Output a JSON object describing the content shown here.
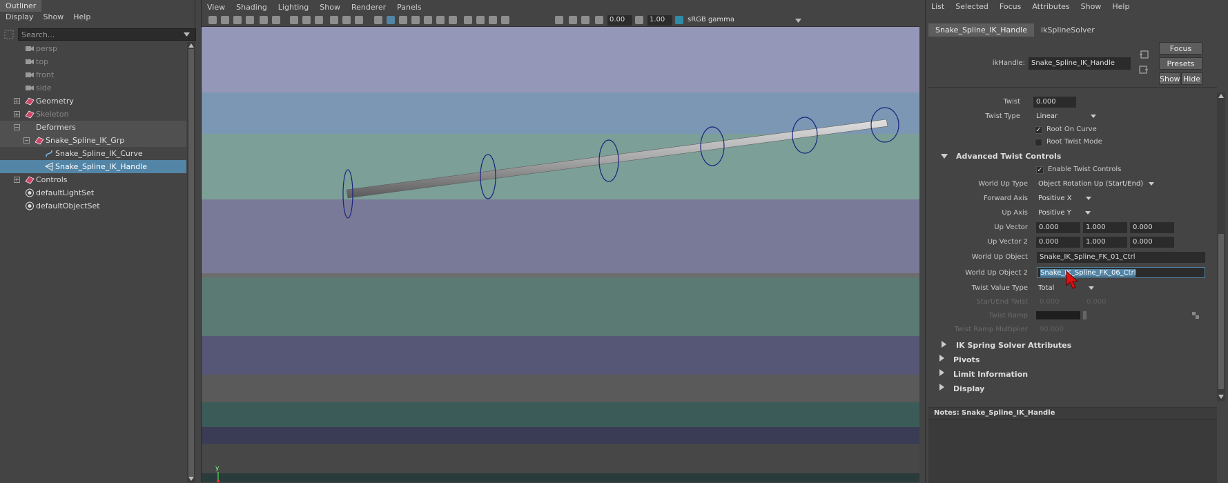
{
  "outliner": {
    "title": "Outliner",
    "menu": [
      "Display",
      "Show",
      "Help"
    ],
    "search_placeholder": "Search...",
    "items": [
      {
        "label": "persp",
        "indent": 0,
        "type": "camera",
        "dim": true
      },
      {
        "label": "top",
        "indent": 0,
        "type": "camera",
        "dim": true
      },
      {
        "label": "front",
        "indent": 0,
        "type": "camera",
        "dim": true
      },
      {
        "label": "side",
        "indent": 0,
        "type": "camera",
        "dim": true
      },
      {
        "label": "Geometry",
        "indent": 0,
        "type": "group",
        "expander": "+"
      },
      {
        "label": "Skeleton",
        "indent": 0,
        "type": "group",
        "expander": "+",
        "dim": true
      },
      {
        "label": "Deformers",
        "indent": 0,
        "type": "none",
        "expander": "-",
        "highlight": true
      },
      {
        "label": "Snake_Spline_IK_Grp",
        "indent": 1,
        "type": "group",
        "expander": "-",
        "highlight": true
      },
      {
        "label": "Snake_Spline_IK_Curve",
        "indent": 2,
        "type": "curve"
      },
      {
        "label": "Snake_Spline_IK_Handle",
        "indent": 2,
        "type": "ikhandle",
        "selected": true
      },
      {
        "label": "Controls",
        "indent": 0,
        "type": "group",
        "expander": "+"
      },
      {
        "label": "defaultLightSet",
        "indent": 0,
        "type": "set"
      },
      {
        "label": "defaultObjectSet",
        "indent": 0,
        "type": "set"
      }
    ]
  },
  "viewport": {
    "menu": [
      "View",
      "Shading",
      "Lighting",
      "Show",
      "Renderer",
      "Panels"
    ],
    "exposure": "0.00",
    "gamma": "1.00",
    "color_space": "sRGB gamma",
    "axis_label": "y"
  },
  "attribute_editor": {
    "menu": [
      "List",
      "Selected",
      "Focus",
      "Attributes",
      "Show",
      "Help"
    ],
    "tabs": [
      "Snake_Spline_IK_Handle",
      "ikSplineSolver"
    ],
    "node_label": "ikHandle:",
    "node_name": "Snake_Spline_IK_Handle",
    "buttons": {
      "focus": "Focus",
      "presets": "Presets",
      "show": "Show",
      "hide": "Hide"
    },
    "twist_label": "Twist",
    "twist_value": "0.000",
    "twist_type_label": "Twist Type",
    "twist_type_value": "Linear",
    "root_on_curve": "Root On Curve",
    "root_twist_mode": "Root Twist Mode",
    "advanced_section": "Advanced Twist Controls",
    "enable_twist": "Enable Twist Controls",
    "world_up_type_label": "World Up Type",
    "world_up_type_value": "Object Rotation Up (Start/End)",
    "forward_axis_label": "Forward Axis",
    "forward_axis_value": "Positive X",
    "up_axis_label": "Up Axis",
    "up_axis_value": "Positive Y",
    "up_vector_label": "Up Vector",
    "up_vector": [
      "0.000",
      "1.000",
      "0.000"
    ],
    "up_vector2_label": "Up Vector 2",
    "up_vector2": [
      "0.000",
      "1.000",
      "0.000"
    ],
    "world_up_object_label": "World Up Object",
    "world_up_object_value": "Snake_IK_Spline_FK_01_Ctrl",
    "world_up_object2_label": "World Up Object 2",
    "world_up_object2_value": "Snake_IK_Spline_FK_06_Ctrl",
    "twist_value_type_label": "Twist Value Type",
    "twist_value_type_value": "Total",
    "start_end_twist_label": "Start/End Twist",
    "start_end_twist": [
      "0.000",
      "0.000"
    ],
    "twist_ramp_label": "Twist Ramp",
    "twist_ramp_mult_label": "Twist Ramp Multiplier",
    "twist_ramp_mult_value": "90.000",
    "collapsed_sections": [
      "IK Spring Solver Attributes",
      "Pivots",
      "Limit Information",
      "Display"
    ],
    "notes_label": "Notes:",
    "notes_value": "Snake_Spline_IK_Handle"
  },
  "colors": {
    "selection": "#5285a6",
    "curve_circle": "#1a237e"
  }
}
